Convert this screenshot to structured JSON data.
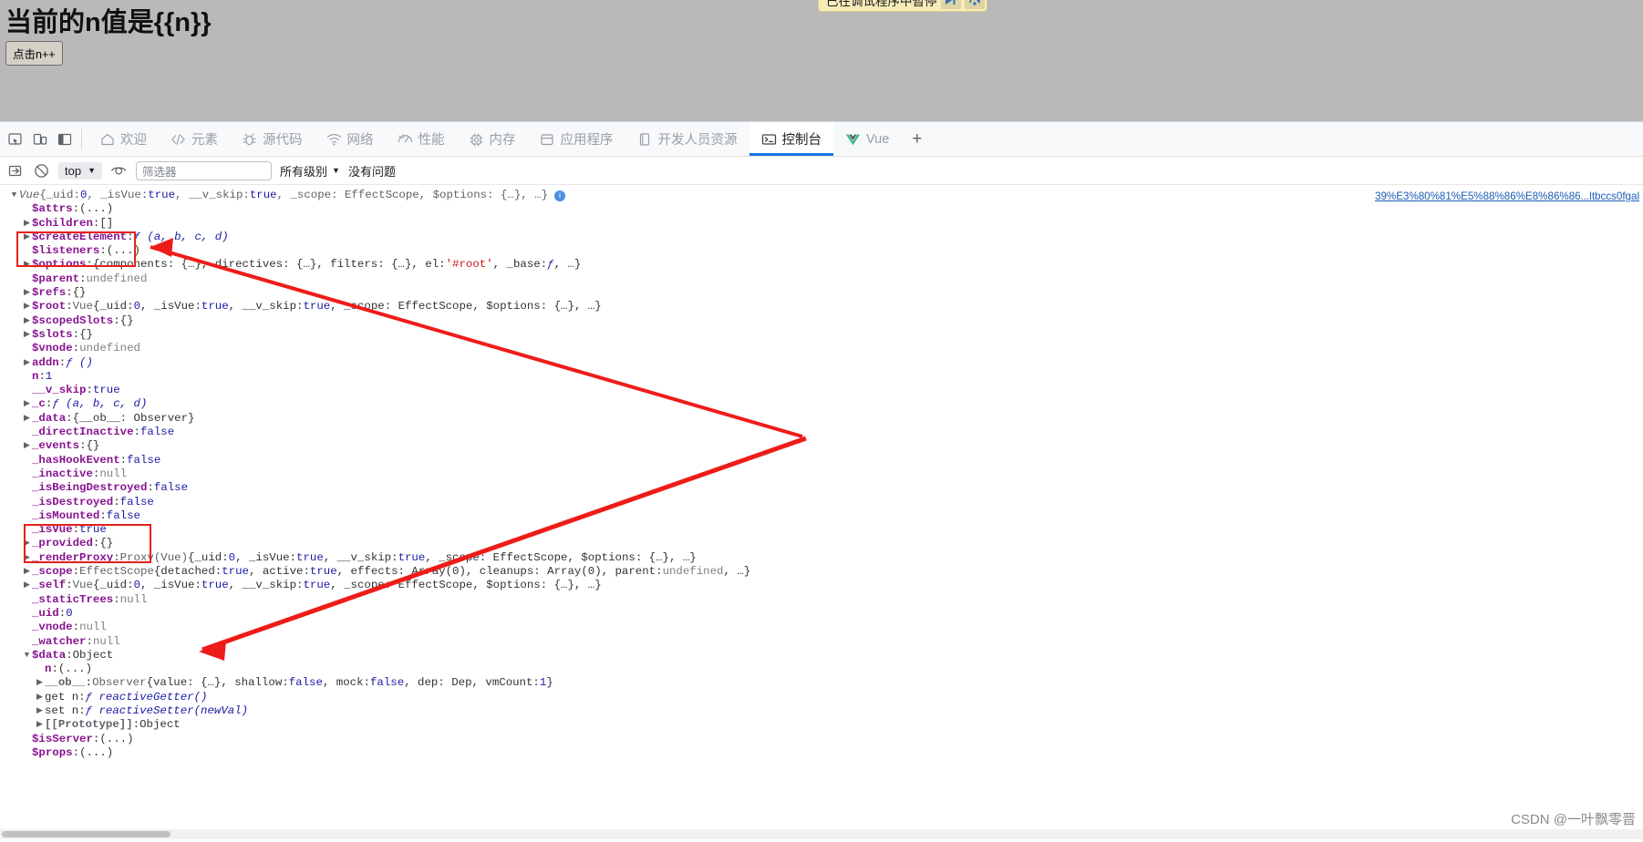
{
  "webpage": {
    "heading": "当前的n值是{{n}}",
    "button_label": "点击n++",
    "pause_banner": {
      "text": "已在调试程序中暂停",
      "resume_icon": "resume-icon",
      "step-over_icon": "step-over-icon"
    }
  },
  "devtools": {
    "toolbar_icons": [
      {
        "name": "inspect-element-icon"
      },
      {
        "name": "device-toolbar-icon"
      },
      {
        "name": "dock-side-icon"
      }
    ],
    "tabs": [
      {
        "label": "欢迎",
        "icon": "home-icon",
        "active": false
      },
      {
        "label": "元素",
        "icon": "code-brackets-icon",
        "active": false
      },
      {
        "label": "源代码",
        "icon": "bug-icon",
        "active": false
      },
      {
        "label": "网络",
        "icon": "wifi-icon",
        "active": false
      },
      {
        "label": "性能",
        "icon": "speedometer-icon",
        "active": false
      },
      {
        "label": "内存",
        "icon": "memory-chip-icon",
        "active": false
      },
      {
        "label": "应用程序",
        "icon": "application-window-icon",
        "active": false
      },
      {
        "label": "开发人员资源",
        "icon": "book-icon",
        "active": false
      },
      {
        "label": "控制台",
        "icon": "console-prompt-icon",
        "active": true
      },
      {
        "label": "Vue",
        "icon": "vue-logo-icon",
        "active": false
      }
    ],
    "add_tab_label": "+",
    "console_toolbar": {
      "clear_icon": "clear-console-icon",
      "no_entry_icon": "no-entry-icon",
      "context_value": "top",
      "eye_icon": "live-expression-eye-icon",
      "filter_placeholder": "筛选器",
      "level_value": "所有级别",
      "issues_text": "没有问题"
    }
  },
  "console": {
    "source_link": "39%E3%80%81%E5%88%86%E8%86%86...ltbccs0fgal",
    "lines": [
      {
        "indent": 0,
        "arrow": "down",
        "segments": [
          {
            "t": "Vue ",
            "c": "cls"
          },
          {
            "t": "{_uid: ",
            "c": "cls-n"
          },
          {
            "t": "0",
            "c": "v-num"
          },
          {
            "t": ", _isVue: ",
            "c": "cls-n"
          },
          {
            "t": "true",
            "c": "v-bool"
          },
          {
            "t": ", __v_skip: ",
            "c": "cls-n"
          },
          {
            "t": "true",
            "c": "v-bool"
          },
          {
            "t": ", _scope: EffectScope, $options: {…}, …}",
            "c": "cls-n"
          },
          {
            "t": "  i",
            "c": "info-badge"
          }
        ]
      },
      {
        "indent": 1,
        "arrow": "none",
        "segments": [
          {
            "t": "$attrs",
            "c": "k"
          },
          {
            "t": ": ",
            "c": "sep"
          },
          {
            "t": "(...)",
            "c": "v-obj"
          }
        ]
      },
      {
        "indent": 1,
        "arrow": "right",
        "segments": [
          {
            "t": "$children",
            "c": "k"
          },
          {
            "t": ": ",
            "c": "sep"
          },
          {
            "t": "[]",
            "c": "v-obj"
          }
        ]
      },
      {
        "indent": 1,
        "arrow": "right",
        "segments": [
          {
            "t": "$createElement",
            "c": "k"
          },
          {
            "t": ": ",
            "c": "sep"
          },
          {
            "t": "ƒ (a, b, c, d)",
            "c": "fn"
          }
        ]
      },
      {
        "indent": 1,
        "arrow": "none",
        "segments": [
          {
            "t": "$listeners",
            "c": "k"
          },
          {
            "t": ": ",
            "c": "sep"
          },
          {
            "t": "(...)",
            "c": "v-obj"
          }
        ]
      },
      {
        "indent": 1,
        "arrow": "right",
        "segments": [
          {
            "t": "$options",
            "c": "k"
          },
          {
            "t": ": ",
            "c": "sep"
          },
          {
            "t": "{components: {…}, directives: {…}, filters: {…}, el: ",
            "c": "v-obj"
          },
          {
            "t": "'#root'",
            "c": "v-str"
          },
          {
            "t": ", _base: ",
            "c": "v-obj"
          },
          {
            "t": "ƒ",
            "c": "fn"
          },
          {
            "t": ", …}",
            "c": "v-obj"
          }
        ]
      },
      {
        "indent": 1,
        "arrow": "none",
        "segments": [
          {
            "t": "$parent",
            "c": "k"
          },
          {
            "t": ": ",
            "c": "sep"
          },
          {
            "t": "undefined",
            "c": "v-null"
          }
        ]
      },
      {
        "indent": 1,
        "arrow": "right",
        "segments": [
          {
            "t": "$refs",
            "c": "k"
          },
          {
            "t": ": ",
            "c": "sep"
          },
          {
            "t": "{}",
            "c": "v-obj"
          }
        ]
      },
      {
        "indent": 1,
        "arrow": "right",
        "segments": [
          {
            "t": "$root",
            "c": "k"
          },
          {
            "t": ": ",
            "c": "sep"
          },
          {
            "t": "Vue ",
            "c": "cls-n"
          },
          {
            "t": "{_uid: ",
            "c": "v-obj"
          },
          {
            "t": "0",
            "c": "v-num"
          },
          {
            "t": ", _isVue: ",
            "c": "v-obj"
          },
          {
            "t": "true",
            "c": "v-bool"
          },
          {
            "t": ", __v_skip: ",
            "c": "v-obj"
          },
          {
            "t": "true",
            "c": "v-bool"
          },
          {
            "t": ", _scope: EffectScope, $options: {…}, …}",
            "c": "v-obj"
          }
        ]
      },
      {
        "indent": 1,
        "arrow": "right",
        "segments": [
          {
            "t": "$scopedSlots",
            "c": "k"
          },
          {
            "t": ": ",
            "c": "sep"
          },
          {
            "t": "{}",
            "c": "v-obj"
          }
        ]
      },
      {
        "indent": 1,
        "arrow": "right",
        "segments": [
          {
            "t": "$slots",
            "c": "k"
          },
          {
            "t": ": ",
            "c": "sep"
          },
          {
            "t": "{}",
            "c": "v-obj"
          }
        ]
      },
      {
        "indent": 1,
        "arrow": "none",
        "segments": [
          {
            "t": "$vnode",
            "c": "k"
          },
          {
            "t": ": ",
            "c": "sep"
          },
          {
            "t": "undefined",
            "c": "v-null"
          }
        ]
      },
      {
        "indent": 1,
        "arrow": "right",
        "segments": [
          {
            "t": "addn",
            "c": "k"
          },
          {
            "t": ": ",
            "c": "sep"
          },
          {
            "t": "ƒ ()",
            "c": "fn"
          }
        ]
      },
      {
        "indent": 1,
        "arrow": "none",
        "segments": [
          {
            "t": "n",
            "c": "k"
          },
          {
            "t": ": ",
            "c": "sep"
          },
          {
            "t": "1",
            "c": "v-num"
          }
        ]
      },
      {
        "indent": 1,
        "arrow": "none",
        "segments": [
          {
            "t": "__v_skip",
            "c": "k"
          },
          {
            "t": ": ",
            "c": "sep"
          },
          {
            "t": "true",
            "c": "v-bool"
          }
        ]
      },
      {
        "indent": 1,
        "arrow": "right",
        "segments": [
          {
            "t": "_c",
            "c": "k"
          },
          {
            "t": ": ",
            "c": "sep"
          },
          {
            "t": "ƒ (a, b, c, d)",
            "c": "fn"
          }
        ]
      },
      {
        "indent": 1,
        "arrow": "right",
        "segments": [
          {
            "t": "_data",
            "c": "k"
          },
          {
            "t": ": ",
            "c": "sep"
          },
          {
            "t": "{__ob__: Observer}",
            "c": "v-obj"
          }
        ]
      },
      {
        "indent": 1,
        "arrow": "none",
        "segments": [
          {
            "t": "_directInactive",
            "c": "k"
          },
          {
            "t": ": ",
            "c": "sep"
          },
          {
            "t": "false",
            "c": "v-bool"
          }
        ]
      },
      {
        "indent": 1,
        "arrow": "right",
        "segments": [
          {
            "t": "_events",
            "c": "k"
          },
          {
            "t": ": ",
            "c": "sep"
          },
          {
            "t": "{}",
            "c": "v-obj"
          }
        ]
      },
      {
        "indent": 1,
        "arrow": "none",
        "segments": [
          {
            "t": "_hasHookEvent",
            "c": "k"
          },
          {
            "t": ": ",
            "c": "sep"
          },
          {
            "t": "false",
            "c": "v-bool"
          }
        ]
      },
      {
        "indent": 1,
        "arrow": "none",
        "segments": [
          {
            "t": "_inactive",
            "c": "k"
          },
          {
            "t": ": ",
            "c": "sep"
          },
          {
            "t": "null",
            "c": "v-null"
          }
        ]
      },
      {
        "indent": 1,
        "arrow": "none",
        "segments": [
          {
            "t": "_isBeingDestroyed",
            "c": "k"
          },
          {
            "t": ": ",
            "c": "sep"
          },
          {
            "t": "false",
            "c": "v-bool"
          }
        ]
      },
      {
        "indent": 1,
        "arrow": "none",
        "segments": [
          {
            "t": "_isDestroyed",
            "c": "k"
          },
          {
            "t": ": ",
            "c": "sep"
          },
          {
            "t": "false",
            "c": "v-bool"
          }
        ]
      },
      {
        "indent": 1,
        "arrow": "none",
        "segments": [
          {
            "t": "_isMounted",
            "c": "k"
          },
          {
            "t": ": ",
            "c": "sep"
          },
          {
            "t": "false",
            "c": "v-bool"
          }
        ]
      },
      {
        "indent": 1,
        "arrow": "none",
        "segments": [
          {
            "t": "_isVue",
            "c": "k"
          },
          {
            "t": ": ",
            "c": "sep"
          },
          {
            "t": "true",
            "c": "v-bool"
          }
        ]
      },
      {
        "indent": 1,
        "arrow": "right",
        "segments": [
          {
            "t": "_provided",
            "c": "k"
          },
          {
            "t": ": ",
            "c": "sep"
          },
          {
            "t": "{}",
            "c": "v-obj"
          }
        ]
      },
      {
        "indent": 1,
        "arrow": "right",
        "segments": [
          {
            "t": "_renderProxy",
            "c": "k"
          },
          {
            "t": ": ",
            "c": "sep"
          },
          {
            "t": "Proxy(Vue) ",
            "c": "cls-n"
          },
          {
            "t": "{_uid: ",
            "c": "v-obj"
          },
          {
            "t": "0",
            "c": "v-num"
          },
          {
            "t": ", _isVue: ",
            "c": "v-obj"
          },
          {
            "t": "true",
            "c": "v-bool"
          },
          {
            "t": ", __v_skip: ",
            "c": "v-obj"
          },
          {
            "t": "true",
            "c": "v-bool"
          },
          {
            "t": ", _scope: EffectScope, $options: {…}, …}",
            "c": "v-obj"
          }
        ]
      },
      {
        "indent": 1,
        "arrow": "right",
        "segments": [
          {
            "t": "_scope",
            "c": "k"
          },
          {
            "t": ": ",
            "c": "sep"
          },
          {
            "t": "EffectScope ",
            "c": "cls-n"
          },
          {
            "t": "{detached: ",
            "c": "v-obj"
          },
          {
            "t": "true",
            "c": "v-bool"
          },
          {
            "t": ", active: ",
            "c": "v-obj"
          },
          {
            "t": "true",
            "c": "v-bool"
          },
          {
            "t": ", effects: Array(0), cleanups: Array(0), parent: ",
            "c": "v-obj"
          },
          {
            "t": "undefined",
            "c": "v-null"
          },
          {
            "t": ", …}",
            "c": "v-obj"
          }
        ]
      },
      {
        "indent": 1,
        "arrow": "right",
        "segments": [
          {
            "t": "_self",
            "c": "k"
          },
          {
            "t": ": ",
            "c": "sep"
          },
          {
            "t": "Vue ",
            "c": "cls-n"
          },
          {
            "t": "{_uid: ",
            "c": "v-obj"
          },
          {
            "t": "0",
            "c": "v-num"
          },
          {
            "t": ", _isVue: ",
            "c": "v-obj"
          },
          {
            "t": "true",
            "c": "v-bool"
          },
          {
            "t": ", __v_skip: ",
            "c": "v-obj"
          },
          {
            "t": "true",
            "c": "v-bool"
          },
          {
            "t": ", _scope: EffectScope, $options: {…}, …}",
            "c": "v-obj"
          }
        ]
      },
      {
        "indent": 1,
        "arrow": "none",
        "segments": [
          {
            "t": "_staticTrees",
            "c": "k"
          },
          {
            "t": ": ",
            "c": "sep"
          },
          {
            "t": "null",
            "c": "v-null"
          }
        ]
      },
      {
        "indent": 1,
        "arrow": "none",
        "segments": [
          {
            "t": "_uid",
            "c": "k"
          },
          {
            "t": ": ",
            "c": "sep"
          },
          {
            "t": "0",
            "c": "v-num"
          }
        ]
      },
      {
        "indent": 1,
        "arrow": "none",
        "segments": [
          {
            "t": "_vnode",
            "c": "k"
          },
          {
            "t": ": ",
            "c": "sep"
          },
          {
            "t": "null",
            "c": "v-null"
          }
        ]
      },
      {
        "indent": 1,
        "arrow": "none",
        "segments": [
          {
            "t": "_watcher",
            "c": "k"
          },
          {
            "t": ": ",
            "c": "sep"
          },
          {
            "t": "null",
            "c": "v-null"
          }
        ]
      },
      {
        "indent": 1,
        "arrow": "down",
        "segments": [
          {
            "t": "$data",
            "c": "k"
          },
          {
            "t": ": ",
            "c": "sep"
          },
          {
            "t": "Object",
            "c": "v-obj"
          }
        ]
      },
      {
        "indent": 2,
        "arrow": "none",
        "segments": [
          {
            "t": "n",
            "c": "k"
          },
          {
            "t": ": ",
            "c": "sep"
          },
          {
            "t": "(...)",
            "c": "v-obj"
          }
        ]
      },
      {
        "indent": 2,
        "arrow": "right",
        "segments": [
          {
            "t": "__ob__",
            "c": "k-dim"
          },
          {
            "t": ": ",
            "c": "sep"
          },
          {
            "t": "Observer ",
            "c": "cls-n"
          },
          {
            "t": "{value: {…}, shallow: ",
            "c": "v-obj"
          },
          {
            "t": "false",
            "c": "v-bool"
          },
          {
            "t": ", mock: ",
            "c": "v-obj"
          },
          {
            "t": "false",
            "c": "v-bool"
          },
          {
            "t": ", dep: Dep, vmCount: ",
            "c": "v-obj"
          },
          {
            "t": "1",
            "c": "v-num"
          },
          {
            "t": "}",
            "c": "v-obj"
          }
        ]
      },
      {
        "indent": 2,
        "arrow": "right",
        "segments": [
          {
            "t": "get n",
            "c": "plain"
          },
          {
            "t": ": ",
            "c": "sep"
          },
          {
            "t": "ƒ reactiveGetter()",
            "c": "fn"
          }
        ]
      },
      {
        "indent": 2,
        "arrow": "right",
        "segments": [
          {
            "t": "set n",
            "c": "plain"
          },
          {
            "t": ": ",
            "c": "sep"
          },
          {
            "t": "ƒ reactiveSetter(newVal)",
            "c": "fn"
          }
        ]
      },
      {
        "indent": 2,
        "arrow": "right",
        "segments": [
          {
            "t": "[[Prototype]]",
            "c": "k-dim"
          },
          {
            "t": ": ",
            "c": "sep"
          },
          {
            "t": "Object",
            "c": "v-obj"
          }
        ]
      },
      {
        "indent": 1,
        "arrow": "none",
        "segments": [
          {
            "t": "$isServer",
            "c": "k"
          },
          {
            "t": ": ",
            "c": "sep"
          },
          {
            "t": "(...)",
            "c": "v-obj"
          }
        ]
      },
      {
        "indent": 1,
        "arrow": "none",
        "segments": [
          {
            "t": "$props",
            "c": "k"
          },
          {
            "t": ": ",
            "c": "sep"
          },
          {
            "t": "(...)",
            "c": "v-obj"
          }
        ]
      }
    ],
    "annotations": [
      {
        "name": "addn-n-highlight"
      },
      {
        "name": "data-object-highlight"
      }
    ]
  },
  "watermark": "CSDN @一叶飘零晋"
}
